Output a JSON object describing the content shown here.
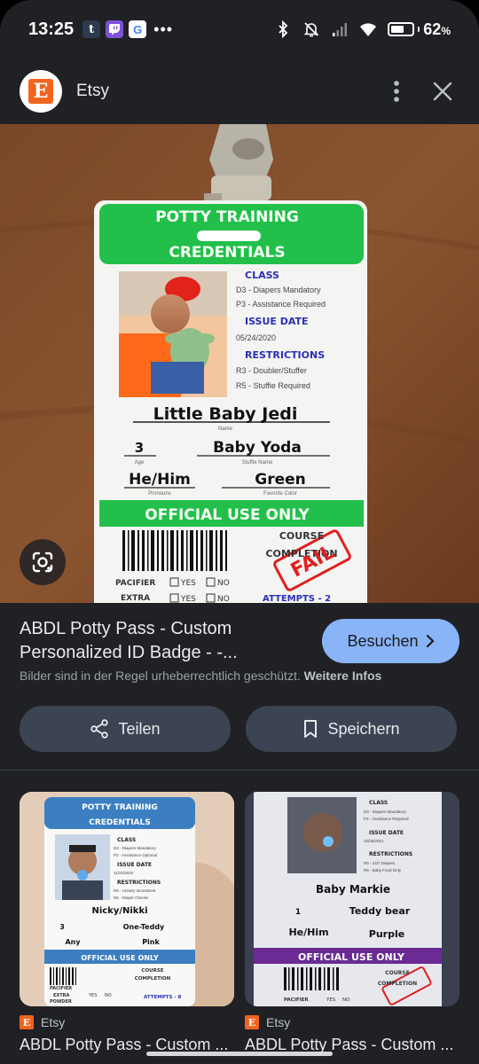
{
  "status_bar": {
    "time": "13:25",
    "notifications": [
      "t",
      "tv",
      "G"
    ],
    "battery_percent": "62",
    "battery_unit": "%",
    "battery_level": 0.62
  },
  "header": {
    "site_logo_letter": "E",
    "site_name": "Etsy",
    "icons": [
      "more-vert-icon",
      "close-icon"
    ]
  },
  "badge": {
    "header_line1": "POTTY TRAINING",
    "header_line2": "CREDENTIALS",
    "class_label": "CLASS",
    "class_lines": [
      "D3 - Diapers Mandatory",
      "P3 - Assistance Required"
    ],
    "issue_label": "ISSUE DATE",
    "issue_date": "05/24/2020",
    "restrictions_label": "RESTRICTIONS",
    "restriction_lines": [
      "R3 - Doubler/Stuffer",
      "R5 - Stuffie Required"
    ],
    "name": "Little Baby Jedi",
    "name_caption": "Name",
    "age": "3",
    "age_caption": "Age",
    "stuffie": "Baby Yoda",
    "stuffie_caption": "Stuffie Name",
    "pronouns": "He/Him",
    "pronouns_caption": "Pronouns",
    "color": "Green",
    "color_caption": "Favorite Color",
    "official": "OFFICIAL USE ONLY",
    "course_line1": "COURSE",
    "course_line2": "COMPLETION",
    "stamp": "FAIL",
    "pacifier_label": "PACIFIER",
    "extra_label": "EXTRA",
    "yes": "YES",
    "no": "NO",
    "attempts": "ATTEMPTS - 2"
  },
  "result": {
    "title": "ABDL Potty Pass - Custom Personalized ID Badge - -...",
    "visit_label": "Besuchen",
    "copyright_text": "Bilder sind in der Regel urheberrechtlich geschützt.",
    "more_info": "Weitere Infos",
    "share_label": "Teilen",
    "save_label": "Speichern"
  },
  "related": [
    {
      "source": "Etsy",
      "title": "ABDL Potty Pass - Custom ...",
      "header_line1": "POTTY TRAINING",
      "header_line2": "CREDENTIALS",
      "class_label": "CLASS",
      "class_lines": [
        "D3 - Diapers Mandatory",
        "P2 - Assistance Optional"
      ],
      "issue_label": "ISSUE DATE",
      "issue_date": "11/22/2020",
      "restrictions_label": "RESTRICTIONS",
      "restriction_lines": [
        "R5 - Urinary Incontinent",
        "R6 - Diaper Checks"
      ],
      "name": "Nicky/Nikki",
      "age": "3",
      "stuffie": "One-Teddy",
      "pronouns": "Any",
      "color": "Pink",
      "official": "OFFICIAL USE ONLY",
      "course_line1": "COURSE",
      "course_line2": "COMPLETION",
      "pacifier_label": "PACIFIER",
      "extra_label": "EXTRA",
      "powder_label": "POWDER",
      "yes": "YES",
      "no": "NO",
      "attempts": "ATTEMPTS - 8"
    },
    {
      "source": "Etsy",
      "title": "ABDL Potty Pass - Custom ...",
      "class_label": "CLASS",
      "class_lines": [
        "D3 - Diapers Mandatory",
        "P3 - Assistance Required"
      ],
      "issue_label": "ISSUE DATE",
      "issue_date": "10/26/2021",
      "restrictions_label": "RESTRICTIONS",
      "restriction_lines": [
        "R5 - 24/7 Diapers",
        "R6 - Baby Food Only"
      ],
      "name": "Baby Markie",
      "age": "1",
      "stuffie": "Teddy bear",
      "pronouns": "He/Him",
      "color": "Purple",
      "official": "OFFICIAL USE ONLY",
      "course_line1": "COURSE",
      "course_line2": "COMPLETION",
      "pacifier_label": "PACIFIER",
      "yes": "YES",
      "no": "NO"
    }
  ],
  "colors": {
    "background": "#202124",
    "accent_button": "#8ab4f8",
    "secondary_button": "#3c4453",
    "badge_green": "#22c04a",
    "badge_purple": "#6a2b95",
    "badge_blue": "#3b7fc2",
    "stamp_red": "#e02020"
  }
}
